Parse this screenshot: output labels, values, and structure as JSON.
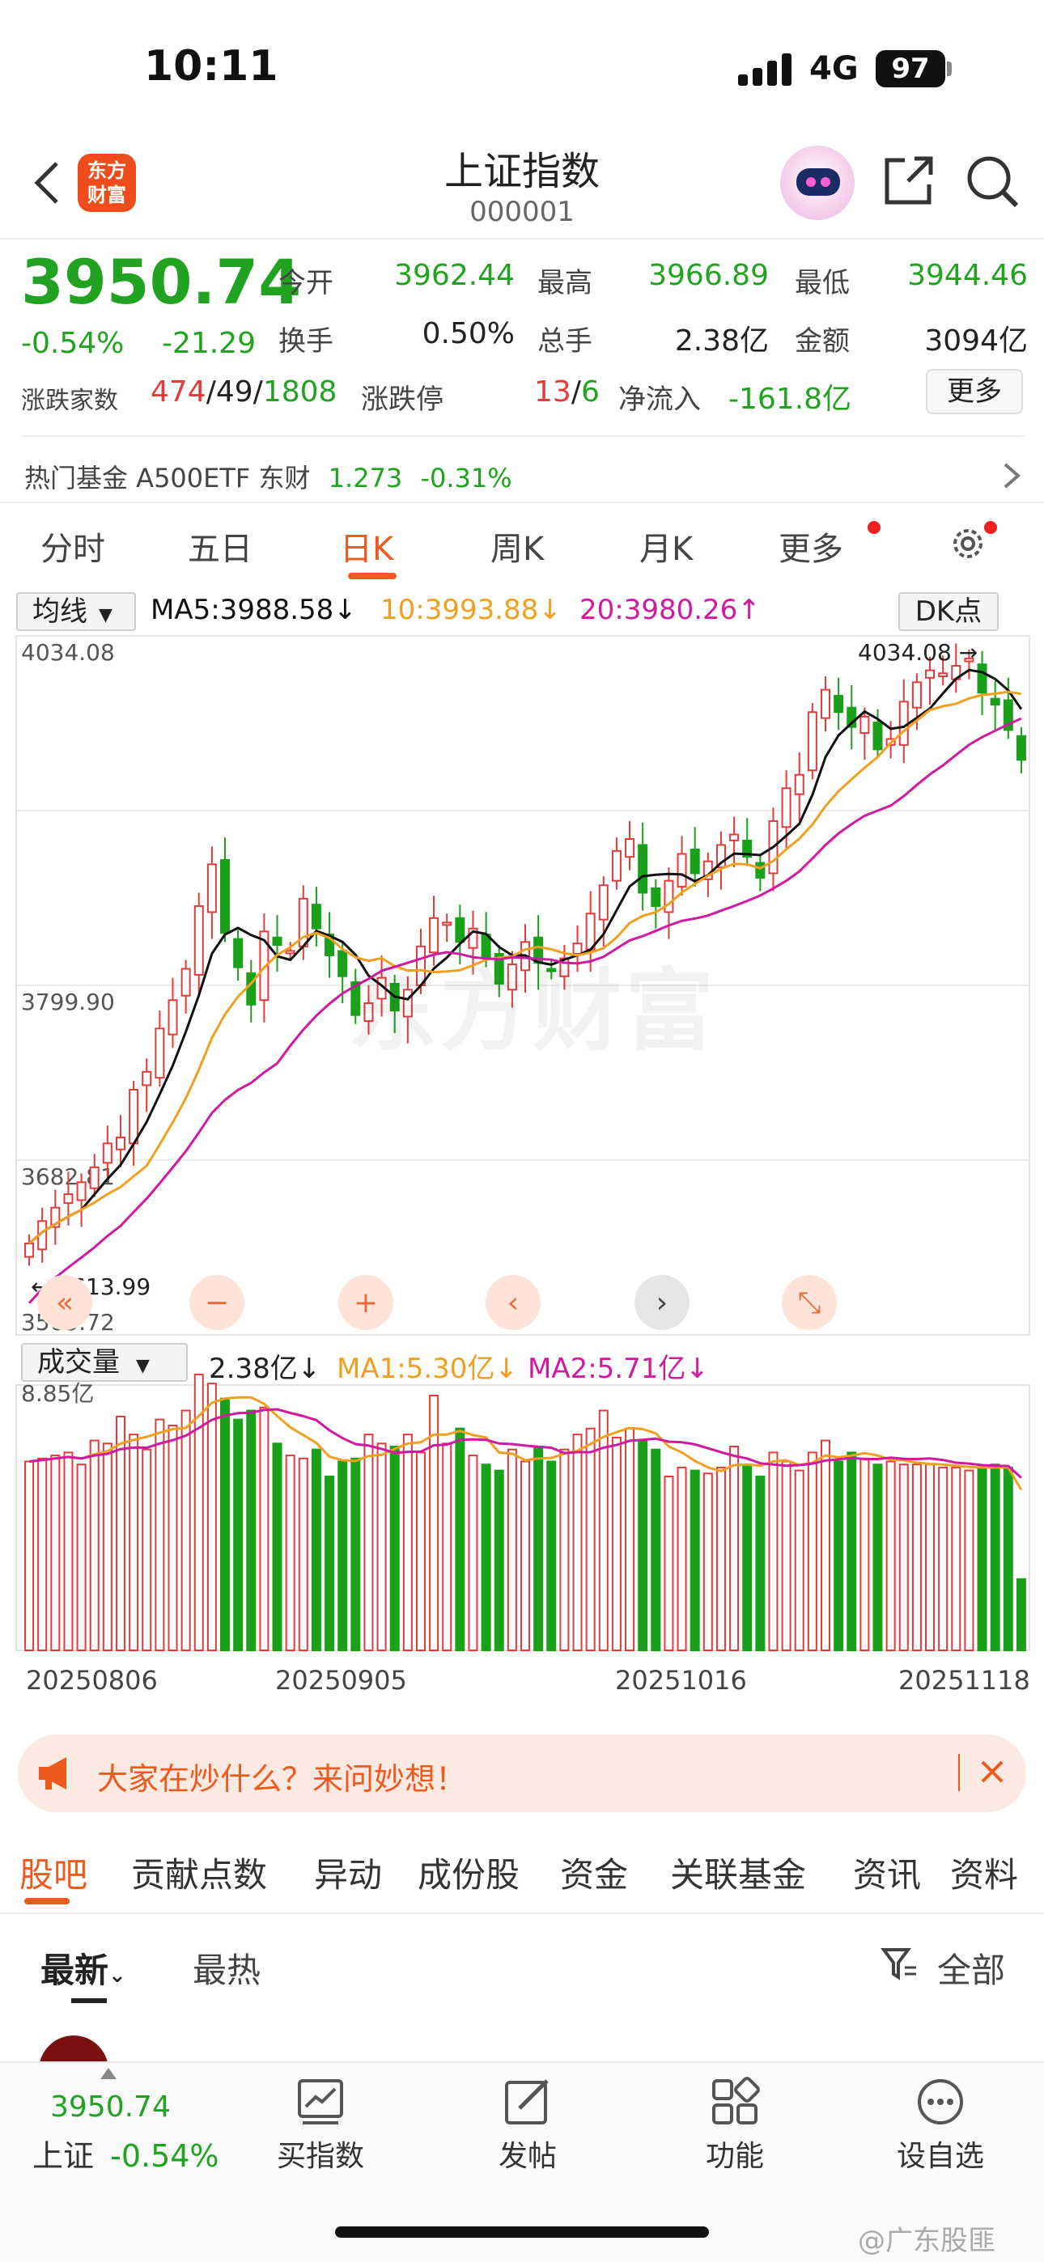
{
  "status": {
    "time": "10:11",
    "network": "4G",
    "battery": "97"
  },
  "header": {
    "logo_text": "东方财富",
    "title": "上证指数",
    "code": "000001"
  },
  "quote": {
    "price": "3950.74",
    "change_pct": "-0.54%",
    "change": "-21.29",
    "open_label": "今开",
    "open": "3962.44",
    "high_label": "最高",
    "high": "3966.89",
    "low_label": "最低",
    "low": "3944.46",
    "turnover_label": "换手",
    "turnover": "0.50%",
    "volume_label": "总手",
    "volume": "2.38亿",
    "amount_label": "金额",
    "amount": "3094亿",
    "breadth_label": "涨跌家数",
    "breadth_up": "474",
    "breadth_sep1": "/",
    "breadth_flat": "49",
    "breadth_sep2": "/",
    "breadth_down": "1808",
    "limit_label": "涨跌停",
    "limit_up": "13",
    "limit_sep": "/",
    "limit_down": "6",
    "netflow_label": "净流入",
    "netflow": "-161.8亿",
    "more": "更多"
  },
  "hot_fund": {
    "text": "热门基金  A500ETF 东财",
    "price": "1.273",
    "change": "-0.31%"
  },
  "period_tabs": [
    "分时",
    "五日",
    "日K",
    "周K",
    "月K",
    "更多"
  ],
  "active_period": "日K",
  "ma": {
    "selector": "均线",
    "ma5": "MA5:3988.58↓",
    "ma10": "10:3993.88↓",
    "ma20": "20:3980.26↑",
    "dk": "DK点",
    "colors": {
      "ma5": "#111111",
      "ma10": "#f0a020",
      "ma20": "#d01aa0",
      "up": "#e23b3b",
      "down": "#1aa01a"
    }
  },
  "vol_legend": {
    "selector": "成交量",
    "vol": "2.38亿↓",
    "ma1": "MA1:5.30亿↓",
    "ma2": "MA2:5.71亿↓",
    "max_label": "8.85亿"
  },
  "chart_data": {
    "type": "candlestick",
    "price_axis_labels": [
      "4034.08",
      "3799.90",
      "3682.81",
      "3565.72"
    ],
    "ylim": [
      3565.72,
      4034.08
    ],
    "high_annotation": "4034.08",
    "low_annotation": "3613.99",
    "x_labels": [
      "20250806",
      "20250905",
      "20251016",
      "20251118"
    ],
    "close": [
      3627,
      3642,
      3651,
      3660,
      3668,
      3678,
      3694,
      3698,
      3730,
      3742,
      3771,
      3790,
      3811,
      3853,
      3881,
      3835,
      3812,
      3787,
      3836,
      3827,
      3823,
      3858,
      3838,
      3820,
      3806,
      3780,
      3788,
      3805,
      3783,
      3797,
      3826,
      3845,
      3842,
      3829,
      3838,
      3818,
      3801,
      3814,
      3829,
      3815,
      3810,
      3818,
      3828,
      3848,
      3867,
      3890,
      3898,
      3862,
      3853,
      3870,
      3888,
      3875,
      3883,
      3894,
      3901,
      3886,
      3872,
      3910,
      3932,
      3941,
      3983,
      3998,
      3983,
      3973,
      3980,
      3958,
      3965,
      3990,
      4003,
      4011,
      4009,
      4014,
      4019,
      3996,
      3988,
      3971,
      3951
    ],
    "volume_billion": [
      6.3,
      6.4,
      6.5,
      6.6,
      6.2,
      7.0,
      6.9,
      7.8,
      7.2,
      6.7,
      7.7,
      7.5,
      8.0,
      9.2,
      8.9,
      8.4,
      7.7,
      8.0,
      8.1,
      6.9,
      6.5,
      6.4,
      6.7,
      5.8,
      6.3,
      6.4,
      7.2,
      6.9,
      6.8,
      7.2,
      6.6,
      8.5,
      6.9,
      7.4,
      6.5,
      6.2,
      6.0,
      6.7,
      6.3,
      6.8,
      6.3,
      6.7,
      7.2,
      7.4,
      8.0,
      7.1,
      7.4,
      7.0,
      6.7,
      5.8,
      6.1,
      6.0,
      5.9,
      6.1,
      6.8,
      6.2,
      5.8,
      6.6,
      6.3,
      6.0,
      6.6,
      7.0,
      6.3,
      6.6,
      6.4,
      6.2,
      6.3,
      6.2,
      6.2,
      6.2,
      6.1,
      6.1,
      6.0,
      6.1,
      6.2,
      6.1,
      2.38
    ]
  },
  "nav_buttons": [
    "«",
    "−",
    "+",
    "‹",
    "›",
    "⤡"
  ],
  "banner": {
    "text": "大家在炒什么？来问妙想！"
  },
  "sub_tabs": [
    "股吧",
    "贡献点数",
    "异动",
    "成份股",
    "资金",
    "关联基金",
    "资讯",
    "资料"
  ],
  "feed_tabs": {
    "latest": "最新",
    "hot": "最热",
    "filter": "全部"
  },
  "bottom_bar": {
    "price": "3950.74",
    "name": "上证",
    "change": "-0.54%",
    "buttons": [
      "买指数",
      "发帖",
      "功能",
      "设自选"
    ]
  },
  "watermark": "东方财富",
  "weibo": "@广东股匪"
}
